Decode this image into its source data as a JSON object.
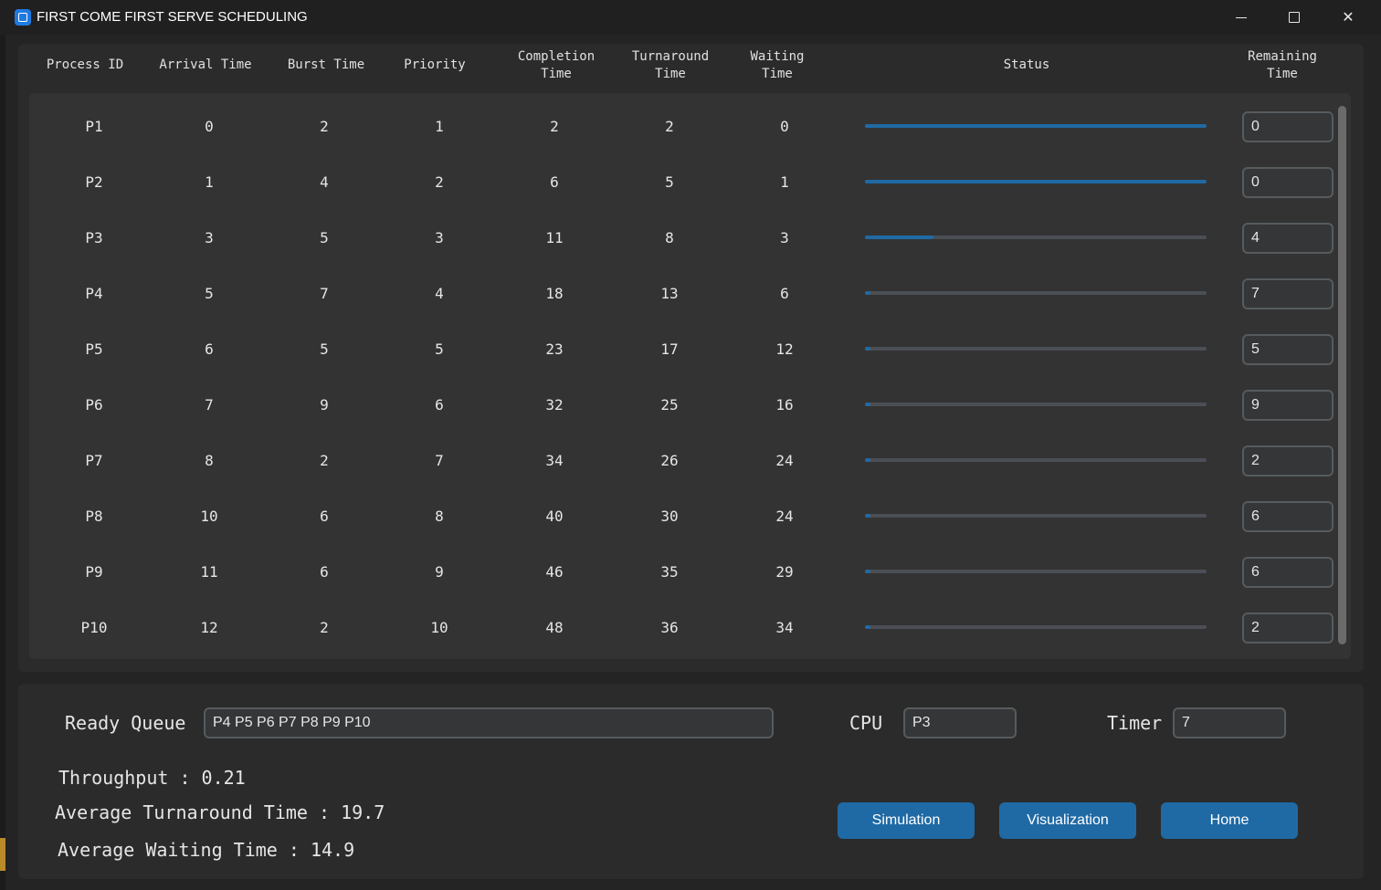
{
  "window": {
    "title": "FIRST COME FIRST SERVE SCHEDULING"
  },
  "table": {
    "headers": {
      "process_id": "Process ID",
      "arrival_time": "Arrival Time",
      "burst_time": "Burst Time",
      "priority": "Priority",
      "completion_1": "Completion",
      "completion_2": "Time",
      "turnaround_1": "Turnaround",
      "turnaround_2": "Time",
      "waiting_1": "Waiting",
      "waiting_2": "Time",
      "status": "Status",
      "remaining_1": "Remaining",
      "remaining_2": "Time"
    },
    "rows": [
      {
        "pid": "P1",
        "arrival": "0",
        "burst": "2",
        "priority": "1",
        "completion": "2",
        "turnaround": "2",
        "waiting": "0",
        "progress": 1.0,
        "remaining": "0"
      },
      {
        "pid": "P2",
        "arrival": "1",
        "burst": "4",
        "priority": "2",
        "completion": "6",
        "turnaround": "5",
        "waiting": "1",
        "progress": 1.0,
        "remaining": "0"
      },
      {
        "pid": "P3",
        "arrival": "3",
        "burst": "5",
        "priority": "3",
        "completion": "11",
        "turnaround": "8",
        "waiting": "3",
        "progress": 0.2,
        "remaining": "4"
      },
      {
        "pid": "P4",
        "arrival": "5",
        "burst": "7",
        "priority": "4",
        "completion": "18",
        "turnaround": "13",
        "waiting": "6",
        "progress": 0.0,
        "remaining": "7"
      },
      {
        "pid": "P5",
        "arrival": "6",
        "burst": "5",
        "priority": "5",
        "completion": "23",
        "turnaround": "17",
        "waiting": "12",
        "progress": 0.0,
        "remaining": "5"
      },
      {
        "pid": "P6",
        "arrival": "7",
        "burst": "9",
        "priority": "6",
        "completion": "32",
        "turnaround": "25",
        "waiting": "16",
        "progress": 0.0,
        "remaining": "9"
      },
      {
        "pid": "P7",
        "arrival": "8",
        "burst": "2",
        "priority": "7",
        "completion": "34",
        "turnaround": "26",
        "waiting": "24",
        "progress": 0.0,
        "remaining": "2"
      },
      {
        "pid": "P8",
        "arrival": "10",
        "burst": "6",
        "priority": "8",
        "completion": "40",
        "turnaround": "30",
        "waiting": "24",
        "progress": 0.0,
        "remaining": "6"
      },
      {
        "pid": "P9",
        "arrival": "11",
        "burst": "6",
        "priority": "9",
        "completion": "46",
        "turnaround": "35",
        "waiting": "29",
        "progress": 0.0,
        "remaining": "6"
      },
      {
        "pid": "P10",
        "arrival": "12",
        "burst": "2",
        "priority": "10",
        "completion": "48",
        "turnaround": "36",
        "waiting": "34",
        "progress": 0.0,
        "remaining": "2"
      }
    ]
  },
  "bottom": {
    "ready_queue_label": "Ready Queue",
    "ready_queue_value": "P4 P5 P6 P7 P8 P9 P10",
    "cpu_label": "CPU",
    "cpu_value": "P3",
    "timer_label": "Timer",
    "timer_value": "7",
    "throughput": "Throughput : 0.21",
    "avg_turnaround": "Average Turnaround Time : 19.7",
    "avg_waiting": "Average Waiting Time : 14.9",
    "buttons": {
      "simulation": "Simulation",
      "visualization": "Visualization",
      "home": "Home"
    }
  },
  "colors": {
    "accent": "#1f6aa5",
    "panel": "#2b2b2b",
    "entry_border": "#565b5e"
  }
}
